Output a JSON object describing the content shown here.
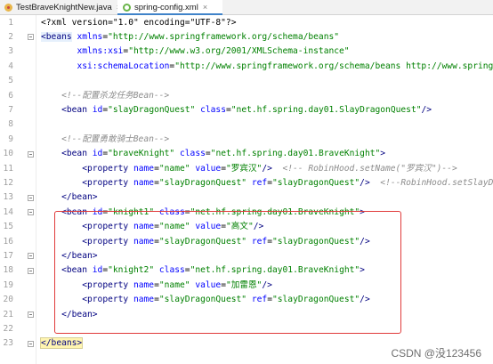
{
  "tabs": [
    {
      "label": "TestBraveKnightNew.java",
      "close": "×",
      "icon": "java-class-icon",
      "active": false
    },
    {
      "label": "spring-config.xml",
      "close": "×",
      "icon": "spring-xml-icon",
      "active": true
    }
  ],
  "lines": [
    {
      "n": "1",
      "tokens": [
        [
          "pi",
          "<?xml version=\"1.0\" encoding=\"UTF-8\"?>"
        ]
      ]
    },
    {
      "n": "2",
      "tokens": [
        [
          "tag hl-tag",
          "<beans"
        ],
        [
          "plain",
          " "
        ],
        [
          "attr",
          "xmlns"
        ],
        [
          "plain",
          "="
        ],
        [
          "val",
          "\"http://www.springframework.org/schema/beans\""
        ]
      ]
    },
    {
      "n": "3",
      "tokens": [
        [
          "plain",
          "       "
        ],
        [
          "attr",
          "xmlns:xsi"
        ],
        [
          "plain",
          "="
        ],
        [
          "val",
          "\"http://www.w3.org/2001/XMLSchema-instance\""
        ]
      ]
    },
    {
      "n": "4",
      "tokens": [
        [
          "plain",
          "       "
        ],
        [
          "attr",
          "xsi:schemaLocation"
        ],
        [
          "plain",
          "="
        ],
        [
          "val",
          "\"http://www.springframework.org/schema/beans http://www.springframework.org/schema/beans/spring-beans.xsd\""
        ]
      ]
    },
    {
      "n": "5",
      "tokens": []
    },
    {
      "n": "6",
      "tokens": [
        [
          "plain",
          "    "
        ],
        [
          "cmt",
          "<!--配置杀龙任务Bean-->"
        ]
      ]
    },
    {
      "n": "7",
      "tokens": [
        [
          "plain",
          "    "
        ],
        [
          "tag",
          "<bean"
        ],
        [
          "plain",
          " "
        ],
        [
          "attr",
          "id"
        ],
        [
          "plain",
          "="
        ],
        [
          "val",
          "\"slayDragonQuest\""
        ],
        [
          "plain",
          " "
        ],
        [
          "attr",
          "class"
        ],
        [
          "plain",
          "="
        ],
        [
          "val",
          "\"net.hf.spring.day01.SlayDragonQuest\""
        ],
        [
          "tag",
          "/>"
        ]
      ]
    },
    {
      "n": "8",
      "tokens": []
    },
    {
      "n": "9",
      "tokens": [
        [
          "plain",
          "    "
        ],
        [
          "cmt",
          "<!--配置勇敢骑士Bean-->"
        ]
      ]
    },
    {
      "n": "10",
      "tokens": [
        [
          "plain",
          "    "
        ],
        [
          "tag",
          "<bean"
        ],
        [
          "plain",
          " "
        ],
        [
          "attr",
          "id"
        ],
        [
          "plain",
          "="
        ],
        [
          "val",
          "\"braveKnight\""
        ],
        [
          "plain",
          " "
        ],
        [
          "attr",
          "class"
        ],
        [
          "plain",
          "="
        ],
        [
          "val",
          "\"net.hf.spring.day01.BraveKnight\""
        ],
        [
          "tag",
          ">"
        ]
      ]
    },
    {
      "n": "11",
      "tokens": [
        [
          "plain",
          "        "
        ],
        [
          "tag",
          "<property"
        ],
        [
          "plain",
          " "
        ],
        [
          "attr",
          "name"
        ],
        [
          "plain",
          "="
        ],
        [
          "val",
          "\"name\""
        ],
        [
          "plain",
          " "
        ],
        [
          "attr",
          "value"
        ],
        [
          "plain",
          "="
        ],
        [
          "val",
          "\"罗宾汉\""
        ],
        [
          "tag",
          "/>"
        ],
        [
          "plain",
          "  "
        ],
        [
          "cmt",
          "<!-- RobinHood.setName(\"罗宾汉\")-->"
        ]
      ]
    },
    {
      "n": "12",
      "tokens": [
        [
          "plain",
          "        "
        ],
        [
          "tag",
          "<property"
        ],
        [
          "plain",
          " "
        ],
        [
          "attr",
          "name"
        ],
        [
          "plain",
          "="
        ],
        [
          "val",
          "\"slayDragonQuest\""
        ],
        [
          "plain",
          " "
        ],
        [
          "attr",
          "ref"
        ],
        [
          "plain",
          "="
        ],
        [
          "val",
          "\"slayDragonQuest\""
        ],
        [
          "tag",
          "/>"
        ],
        [
          "plain",
          "  "
        ],
        [
          "cmt",
          "<!--RobinHood.setSlayDragonQuest(slayDragonQuest)-->"
        ]
      ]
    },
    {
      "n": "13",
      "tokens": [
        [
          "plain",
          "    "
        ],
        [
          "tag",
          "</bean>"
        ]
      ]
    },
    {
      "n": "14",
      "tokens": [
        [
          "plain",
          "    "
        ],
        [
          "tag",
          "<bean"
        ],
        [
          "plain",
          " "
        ],
        [
          "attr",
          "id"
        ],
        [
          "plain",
          "="
        ],
        [
          "val",
          "\"knight1\""
        ],
        [
          "plain",
          " "
        ],
        [
          "attr",
          "class"
        ],
        [
          "plain",
          "="
        ],
        [
          "val",
          "\"net.hf.spring.day01.BraveKnight\""
        ],
        [
          "tag",
          ">"
        ]
      ]
    },
    {
      "n": "15",
      "tokens": [
        [
          "plain",
          "        "
        ],
        [
          "tag",
          "<property"
        ],
        [
          "plain",
          " "
        ],
        [
          "attr",
          "name"
        ],
        [
          "plain",
          "="
        ],
        [
          "val",
          "\"name\""
        ],
        [
          "plain",
          " "
        ],
        [
          "attr",
          "value"
        ],
        [
          "plain",
          "="
        ],
        [
          "val",
          "\"高文\""
        ],
        [
          "tag",
          "/>"
        ]
      ]
    },
    {
      "n": "16",
      "tokens": [
        [
          "plain",
          "        "
        ],
        [
          "tag",
          "<property"
        ],
        [
          "plain",
          " "
        ],
        [
          "attr",
          "name"
        ],
        [
          "plain",
          "="
        ],
        [
          "val",
          "\"slayDragonQuest\""
        ],
        [
          "plain",
          " "
        ],
        [
          "attr",
          "ref"
        ],
        [
          "plain",
          "="
        ],
        [
          "val",
          "\"slayDragonQuest\""
        ],
        [
          "tag",
          "/>"
        ]
      ]
    },
    {
      "n": "17",
      "tokens": [
        [
          "plain",
          "    "
        ],
        [
          "tag",
          "</bean>"
        ]
      ]
    },
    {
      "n": "18",
      "tokens": [
        [
          "plain",
          "    "
        ],
        [
          "tag",
          "<bean"
        ],
        [
          "plain",
          " "
        ],
        [
          "attr",
          "id"
        ],
        [
          "plain",
          "="
        ],
        [
          "val",
          "\"knight2\""
        ],
        [
          "plain",
          " "
        ],
        [
          "attr",
          "class"
        ],
        [
          "plain",
          "="
        ],
        [
          "val",
          "\"net.hf.spring.day01.BraveKnight\""
        ],
        [
          "tag",
          ">"
        ]
      ]
    },
    {
      "n": "19",
      "tokens": [
        [
          "plain",
          "        "
        ],
        [
          "tag",
          "<property"
        ],
        [
          "plain",
          " "
        ],
        [
          "attr",
          "name"
        ],
        [
          "plain",
          "="
        ],
        [
          "val",
          "\"name\""
        ],
        [
          "plain",
          " "
        ],
        [
          "attr",
          "value"
        ],
        [
          "plain",
          "="
        ],
        [
          "val",
          "\"加雷恩\""
        ],
        [
          "tag",
          "/>"
        ]
      ]
    },
    {
      "n": "20",
      "tokens": [
        [
          "plain",
          "        "
        ],
        [
          "tag",
          "<property"
        ],
        [
          "plain",
          " "
        ],
        [
          "attr",
          "name"
        ],
        [
          "plain",
          "="
        ],
        [
          "val",
          "\"slayDragonQuest\""
        ],
        [
          "plain",
          " "
        ],
        [
          "attr",
          "ref"
        ],
        [
          "plain",
          "="
        ],
        [
          "val",
          "\"slayDragonQuest\""
        ],
        [
          "tag",
          "/>"
        ]
      ]
    },
    {
      "n": "21",
      "tokens": [
        [
          "plain",
          "    "
        ],
        [
          "tag",
          "</bean>"
        ]
      ]
    },
    {
      "n": "22",
      "tokens": []
    },
    {
      "n": "23",
      "tokens": [
        [
          "tag hl-close",
          "</beans>"
        ],
        [
          "cursor",
          ""
        ]
      ]
    }
  ],
  "folds": [
    "2",
    "10",
    "13",
    "14",
    "17",
    "18",
    "21",
    "23"
  ],
  "watermark": "CSDN @没123456",
  "colors": {
    "tag": "#000080",
    "attribute": "#0000ff",
    "value": "#008000",
    "comment": "#8c8c8c",
    "highlight_box": "#e03a3a"
  }
}
